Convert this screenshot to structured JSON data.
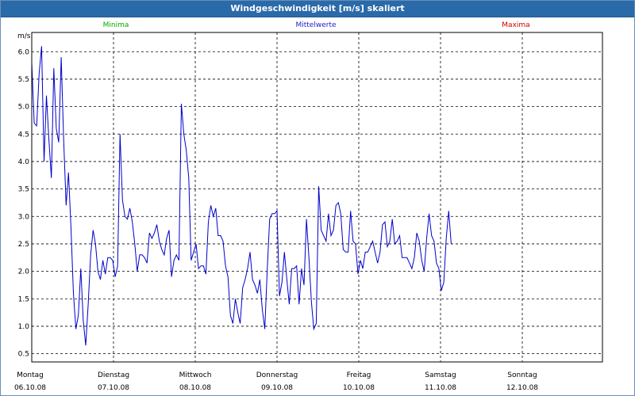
{
  "title": "Windgeschwindigkeit [m/s] skaliert",
  "legend": {
    "minima": {
      "label": "Minima",
      "color": "#00aa00"
    },
    "mittelwerte": {
      "label": "Mittelwerte",
      "color": "#2222cc"
    },
    "maxima": {
      "label": "Maxima",
      "color": "#cc0000"
    }
  },
  "chart_data": {
    "type": "line",
    "title": "Windgeschwindigkeit [m/s] skaliert",
    "ylabel": "m/s",
    "xlabel": "",
    "ylim": [
      0.35,
      6.35
    ],
    "xlim": [
      0,
      6.98
    ],
    "yticks": [
      0.5,
      1.0,
      1.5,
      2.0,
      2.5,
      3.0,
      3.5,
      4.0,
      4.5,
      5.0,
      5.5,
      6.0
    ],
    "ytick_labels": [
      "0.5",
      "1.0",
      "1.5",
      "2.0",
      "2.5",
      "3.0",
      "3.5",
      "4.0",
      "4.5",
      "5.0",
      "5.5",
      "6.0"
    ],
    "x_days": [
      {
        "day": "Montag",
        "date": "06.10.08"
      },
      {
        "day": "Dienstag",
        "date": "07.10.08"
      },
      {
        "day": "Mittwoch",
        "date": "08.10.08"
      },
      {
        "day": "Donnerstag",
        "date": "09.10.08"
      },
      {
        "day": "Freitag",
        "date": "10.10.08"
      },
      {
        "day": "Samstag",
        "date": "11.10.08"
      },
      {
        "day": "Sonntag",
        "date": "12.10.08"
      }
    ],
    "grid": true,
    "series": [
      {
        "name": "Mittelwerte",
        "color": "#0000cc",
        "x_step_days": 0.03,
        "values": [
          5.8,
          4.7,
          4.65,
          5.6,
          6.1,
          4.0,
          5.2,
          4.4,
          3.7,
          5.7,
          4.6,
          4.35,
          5.9,
          4.4,
          3.2,
          3.8,
          2.8,
          1.6,
          0.95,
          1.2,
          2.05,
          1.1,
          0.65,
          1.4,
          2.3,
          2.75,
          2.5,
          2.0,
          1.85,
          2.2,
          1.95,
          2.25,
          2.25,
          2.2,
          1.9,
          2.1,
          4.5,
          3.3,
          3.0,
          2.95,
          3.15,
          2.9,
          2.5,
          2.0,
          2.3,
          2.3,
          2.25,
          2.15,
          2.7,
          2.6,
          2.7,
          2.85,
          2.55,
          2.4,
          2.3,
          2.6,
          2.75,
          1.9,
          2.2,
          2.3,
          2.2,
          5.05,
          4.5,
          4.2,
          3.7,
          2.2,
          2.35,
          2.5,
          2.05,
          2.1,
          2.1,
          1.95,
          2.9,
          3.2,
          3.0,
          3.15,
          2.65,
          2.65,
          2.55,
          2.1,
          1.9,
          1.2,
          1.05,
          1.5,
          1.25,
          1.05,
          1.7,
          1.85,
          2.05,
          2.35,
          1.85,
          1.75,
          1.6,
          1.85,
          1.3,
          0.95,
          2.0,
          2.95,
          3.05,
          3.05,
          3.1,
          1.55,
          1.8,
          2.35,
          1.85,
          1.4,
          2.05,
          2.05,
          2.1,
          1.4,
          2.05,
          1.75,
          2.95,
          2.25,
          1.45,
          0.95,
          1.05,
          3.55,
          2.75,
          2.65,
          2.55,
          3.05,
          2.65,
          2.75,
          3.2,
          3.25,
          3.05,
          2.4,
          2.35,
          2.35,
          3.1,
          2.55,
          2.5,
          1.95,
          2.2,
          2.05,
          2.35,
          2.35,
          2.45,
          2.55,
          2.35,
          2.15,
          2.35,
          2.85,
          2.9,
          2.45,
          2.55,
          2.95,
          2.5,
          2.55,
          2.65,
          2.25,
          2.25,
          2.25,
          2.15,
          2.05,
          2.25,
          2.7,
          2.55,
          2.2,
          2.0,
          2.6,
          3.05,
          2.65,
          2.55,
          2.15,
          2.05,
          1.65,
          1.8,
          2.6,
          3.1,
          2.5
        ]
      }
    ]
  }
}
